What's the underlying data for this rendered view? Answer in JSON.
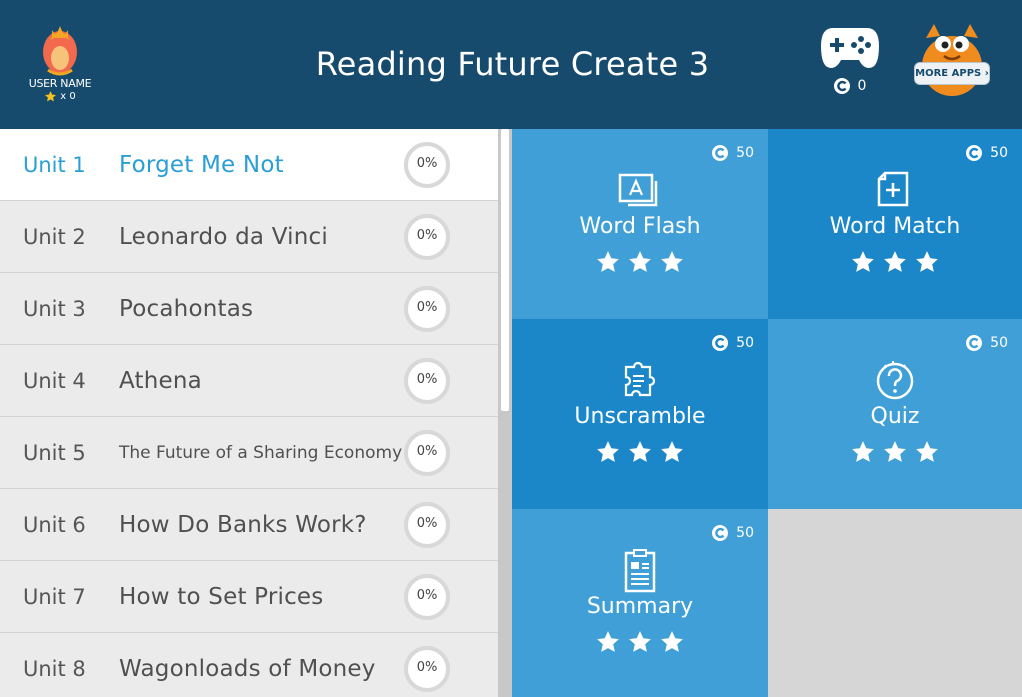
{
  "header": {
    "title": "Reading Future Create 3",
    "user_name": "USER NAME",
    "star_count": "x 0",
    "coin_count": "0",
    "more_apps_label": "MORE APPS"
  },
  "units": [
    {
      "label": "Unit 1",
      "title": "Forget Me Not",
      "progress": "0%"
    },
    {
      "label": "Unit 2",
      "title": "Leonardo da Vinci",
      "progress": "0%"
    },
    {
      "label": "Unit 3",
      "title": "Pocahontas",
      "progress": "0%"
    },
    {
      "label": "Unit 4",
      "title": "Athena",
      "progress": "0%"
    },
    {
      "label": "Unit 5",
      "title": "The Future of a Sharing Economy",
      "progress": "0%"
    },
    {
      "label": "Unit 6",
      "title": "How Do Banks Work?",
      "progress": "0%"
    },
    {
      "label": "Unit 7",
      "title": "How to Set Prices",
      "progress": "0%"
    },
    {
      "label": "Unit 8",
      "title": "Wagonloads of Money",
      "progress": "0%"
    }
  ],
  "selected_unit": "Unit 1",
  "activities": [
    {
      "label": "Word Flash",
      "cost": "50",
      "icon": "flashcards-icon"
    },
    {
      "label": "Word Match",
      "cost": "50",
      "icon": "add-card-icon"
    },
    {
      "label": "Unscramble",
      "cost": "50",
      "icon": "puzzle-list-icon"
    },
    {
      "label": "Quiz",
      "cost": "50",
      "icon": "question-bubble-icon"
    },
    {
      "label": "Summary",
      "cost": "50",
      "icon": "clipboard-doc-icon"
    }
  ],
  "colors": {
    "header_bg": "#174b6d",
    "active_unit": "#2a9fd6",
    "tile_light": "#3f9fd6",
    "tile_dark": "#1b87c9"
  }
}
